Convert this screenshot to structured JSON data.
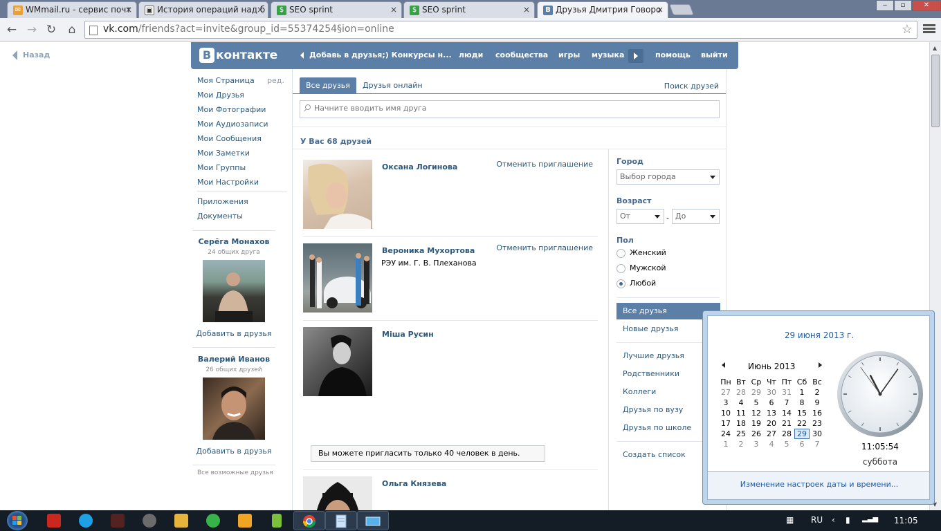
{
  "browser": {
    "tabs": [
      {
        "title": "WMmail.ru - сервис почт",
        "icon": "wmmail-icon"
      },
      {
        "title": "История операций над б",
        "icon": "gift-icon"
      },
      {
        "title": "SEO sprint",
        "icon": "seosprint-icon"
      },
      {
        "title": "SEO sprint",
        "icon": "seosprint-icon"
      },
      {
        "title": "Друзья Дмитрия Говоро",
        "icon": "vk-icon"
      }
    ],
    "url_host": "vk.com",
    "url_rest": "/friends?act=invite&group_id=55374254§ion=online"
  },
  "page": {
    "back": "Назад",
    "header": {
      "logo_word": "контакте",
      "status": "Добавь в друзья;) Конкурсы н...",
      "nav": [
        "люди",
        "сообщества",
        "игры",
        "музыка",
        "помощь",
        "выйти"
      ]
    },
    "left_nav": {
      "items": [
        "Моя Страница",
        "Мои Друзья",
        "Мои Фотографии",
        "Мои Аудиозаписи",
        "Мои Сообщения",
        "Мои Заметки",
        "Мои Группы",
        "Мои Настройки"
      ],
      "edit": "ред.",
      "extra": [
        "Приложения",
        "Документы"
      ]
    },
    "suggestions": [
      {
        "name": "Серёга Монахов",
        "mutual": "24 общих друга",
        "add": "Добавить в друзья"
      },
      {
        "name": "Валерий Иванов",
        "mutual": "26 общих друзей",
        "add": "Добавить в друзья"
      }
    ],
    "all_possible": "Все возможные друзья",
    "tabs": {
      "all": "Все друзья",
      "online": "Друзья онлайн",
      "find": "Поиск друзей"
    },
    "search_placeholder": "Начните вводить имя друга",
    "friends_count": "У Вас 68 друзей",
    "friends": [
      {
        "name": "Оксана Логинова",
        "uni": "",
        "action": "Отменить приглашение"
      },
      {
        "name": "Вероника Мухортова",
        "uni": "РЭУ им. Г. В. Плеханова",
        "action": "Отменить приглашение"
      },
      {
        "name": "Міша Русин",
        "uni": "",
        "action": ""
      },
      {
        "name": "Ольга Князева",
        "uni": "",
        "action": ""
      }
    ],
    "invite_limit": "Вы можете пригласить только 40 человек в день.",
    "filters": {
      "city_label": "Город",
      "city_value": "Выбор города",
      "age_label": "Возраст",
      "age_from": "От",
      "age_to": "До",
      "sex_label": "Пол",
      "sex_options": [
        "Женский",
        "Мужской",
        "Любой"
      ],
      "sex_selected": "Любой",
      "menu": [
        "Все друзья",
        "Новые друзья",
        "Лучшие друзья",
        "Родственники",
        "Коллеги",
        "Друзья по вузу",
        "Друзья по школе",
        "Создать список"
      ]
    }
  },
  "calendar": {
    "date_title": "29 июня 2013 г.",
    "month": "Июнь 2013",
    "weekdays": [
      "Пн",
      "Вт",
      "Ср",
      "Чт",
      "Пт",
      "Сб",
      "Вс"
    ],
    "weeks": [
      [
        "27",
        "28",
        "29",
        "30",
        "31",
        "1",
        "2"
      ],
      [
        "3",
        "4",
        "5",
        "6",
        "7",
        "8",
        "9"
      ],
      [
        "10",
        "11",
        "12",
        "13",
        "14",
        "15",
        "16"
      ],
      [
        "17",
        "18",
        "19",
        "20",
        "21",
        "22",
        "23"
      ],
      [
        "24",
        "25",
        "26",
        "27",
        "28",
        "29",
        "30"
      ],
      [
        "1",
        "2",
        "3",
        "4",
        "5",
        "6",
        "7"
      ]
    ],
    "today": "29",
    "time": "11:05:54",
    "weekday": "суббота",
    "change_link": "Изменение настроек даты и времени..."
  },
  "taskbar": {
    "lang": "RU",
    "time": "11:05"
  },
  "colors": {
    "vk_blue": "#5b7fa6",
    "vk_link": "#2b587a",
    "taskbar": "#141c26"
  }
}
